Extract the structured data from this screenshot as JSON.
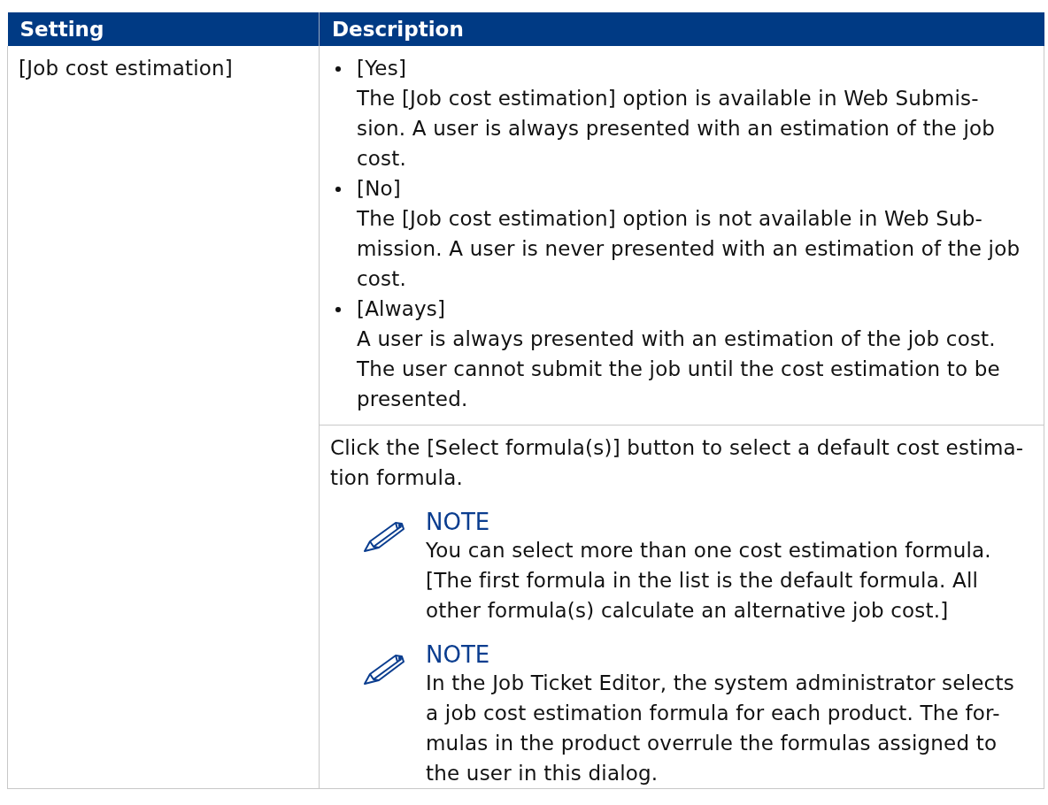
{
  "table": {
    "columns": [
      "Setting",
      "Description"
    ],
    "rows": [
      {
        "setting": "[Job cost estimation]",
        "options": [
          {
            "label": "[Yes]",
            "text": "The [Job cost estimation] option is available in Web Submis-\nsion. A user is always presented with an estimation of the job\ncost."
          },
          {
            "label": "[No]",
            "text": "The [Job cost estimation] option is not available in Web Sub-\nmission. A user is never presented with an estimation of the job\ncost."
          },
          {
            "label": "[Always]",
            "text": "A user is always presented with an estimation of the job cost.\nThe user cannot submit the job until the cost estimation to be\npresented."
          }
        ],
        "detail": {
          "text": "Click the [Select formula(s)] button to select a default cost estima-\ntion formula.",
          "notes": [
            {
              "title": "NOTE",
              "text": "You can select more than one cost estimation formula.\n[The first formula in the list is the default formula. All\nother formula(s) calculate an alternative job cost.]"
            },
            {
              "title": "NOTE",
              "text": "In the Job Ticket Editor, the system administrator selects\na job cost estimation formula for each product. The for-\nmulas in the product overrule the formulas assigned to\nthe user in this dialog."
            }
          ]
        }
      }
    ]
  }
}
